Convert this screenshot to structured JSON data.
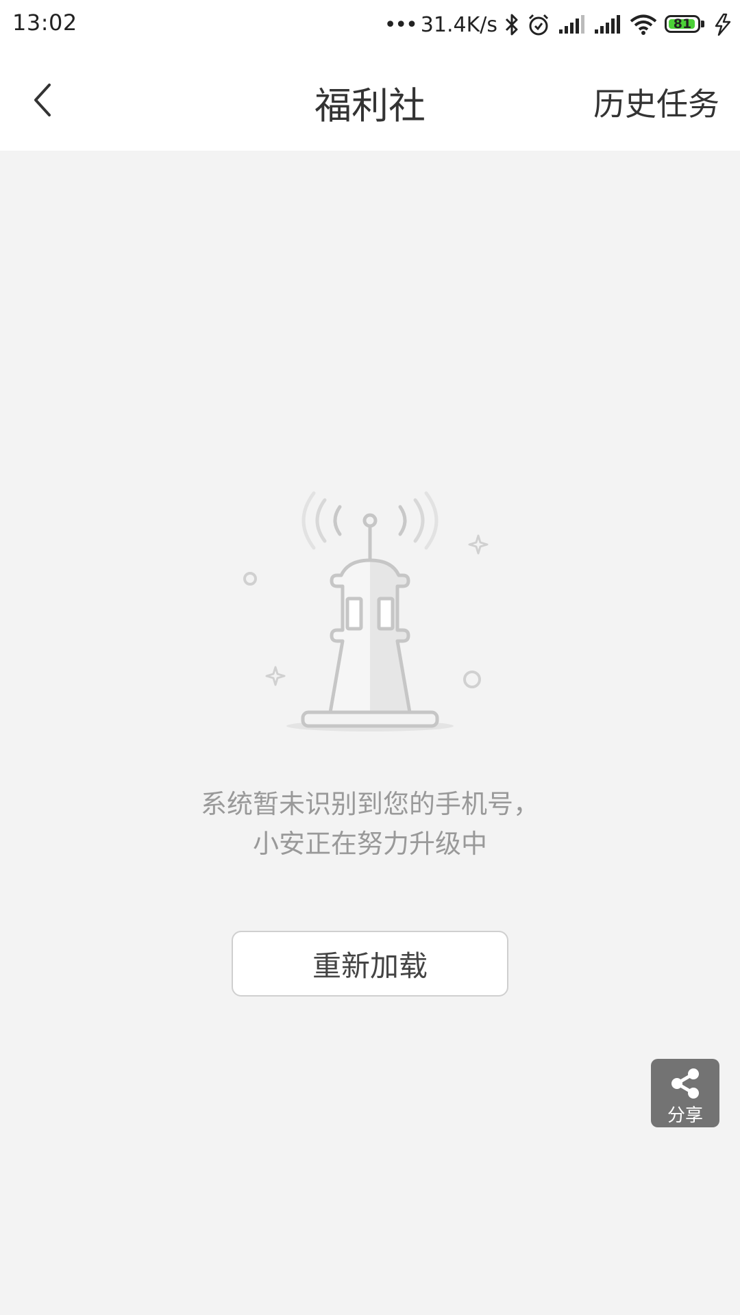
{
  "status_bar": {
    "time": "13:02",
    "dots": "•••",
    "net_speed": "31.4K/s",
    "battery_level": "81",
    "battery_color": "#4cd137",
    "icons": [
      "bluetooth-icon",
      "alarm-icon",
      "signal-icon",
      "signal-icon",
      "wifi-icon",
      "battery-icon",
      "charging-icon"
    ]
  },
  "header": {
    "back_icon": "chevron-left-icon",
    "title": "福利社",
    "history_label": "历史任务"
  },
  "empty_state": {
    "illustration": "lighthouse-broadcast-illustration",
    "message_line1": "系统暂未识别到您的手机号，",
    "message_line2": "小安正在努力升级中",
    "reload_label": "重新加载"
  },
  "share": {
    "icon": "share-icon",
    "label": "分享"
  }
}
